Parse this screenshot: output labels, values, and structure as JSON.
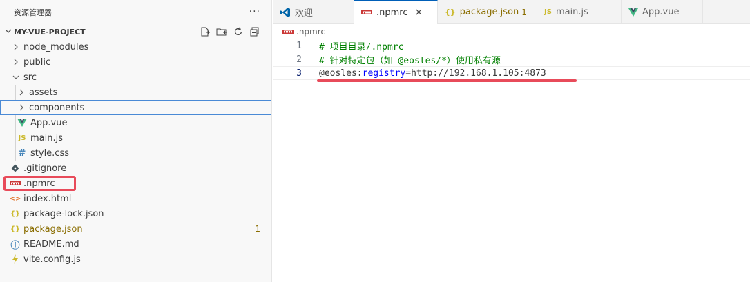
{
  "sidebar": {
    "title": "资源管理器",
    "more_label": "···",
    "project": {
      "name": "MY-VUE-PROJECT"
    },
    "items": [
      {
        "label": "node_modules",
        "type": "folder",
        "expanded": false
      },
      {
        "label": "public",
        "type": "folder",
        "expanded": false
      },
      {
        "label": "src",
        "type": "folder",
        "expanded": true
      },
      {
        "label": "assets",
        "type": "folder",
        "expanded": false
      },
      {
        "label": "components",
        "type": "folder",
        "expanded": false,
        "selected": true
      },
      {
        "label": "App.vue",
        "type": "vue",
        "icon_text": ""
      },
      {
        "label": "main.js",
        "type": "js",
        "icon_text": "JS"
      },
      {
        "label": "style.css",
        "type": "css",
        "icon_text": "#"
      },
      {
        "label": ".gitignore",
        "type": "git"
      },
      {
        "label": ".npmrc",
        "type": "npm"
      },
      {
        "label": "index.html",
        "type": "html",
        "icon_text": "<>"
      },
      {
        "label": "package-lock.json",
        "type": "json",
        "icon_text": "{}"
      },
      {
        "label": "package.json",
        "type": "json",
        "icon_text": "{}",
        "badge": "1"
      },
      {
        "label": "README.md",
        "type": "info",
        "icon_text": "ⓘ"
      },
      {
        "label": "vite.config.js",
        "type": "vite"
      }
    ]
  },
  "tabs": [
    {
      "label": "欢迎",
      "icon": "vscode-icon",
      "active": false
    },
    {
      "label": ".npmrc",
      "icon": "npm-icon",
      "active": true,
      "close": "×"
    },
    {
      "label": "package.json",
      "icon": "json-icon",
      "icon_text": "{}",
      "active": false,
      "badge": "1"
    },
    {
      "label": "main.js",
      "icon": "js-icon",
      "icon_text": "JS",
      "active": false
    },
    {
      "label": "App.vue",
      "icon": "vue-icon",
      "active": false
    }
  ],
  "breadcrumb": {
    "file": ".npmrc"
  },
  "code": {
    "lines": [
      {
        "num": "1",
        "text": "# 项目目录/.npmrc"
      },
      {
        "num": "2",
        "text": "# 针对特定包（如 @eosles/*）使用私有源"
      },
      {
        "num": "3",
        "scope": "@eosles",
        "colon": ":",
        "key": "registry",
        "eq": "=",
        "url": "http://192.168.1.105:4873"
      }
    ]
  },
  "colors": {
    "highlight": "#e84b5a",
    "comment": "#008000",
    "keyword": "#0000ff",
    "accent": "#005fb8"
  }
}
